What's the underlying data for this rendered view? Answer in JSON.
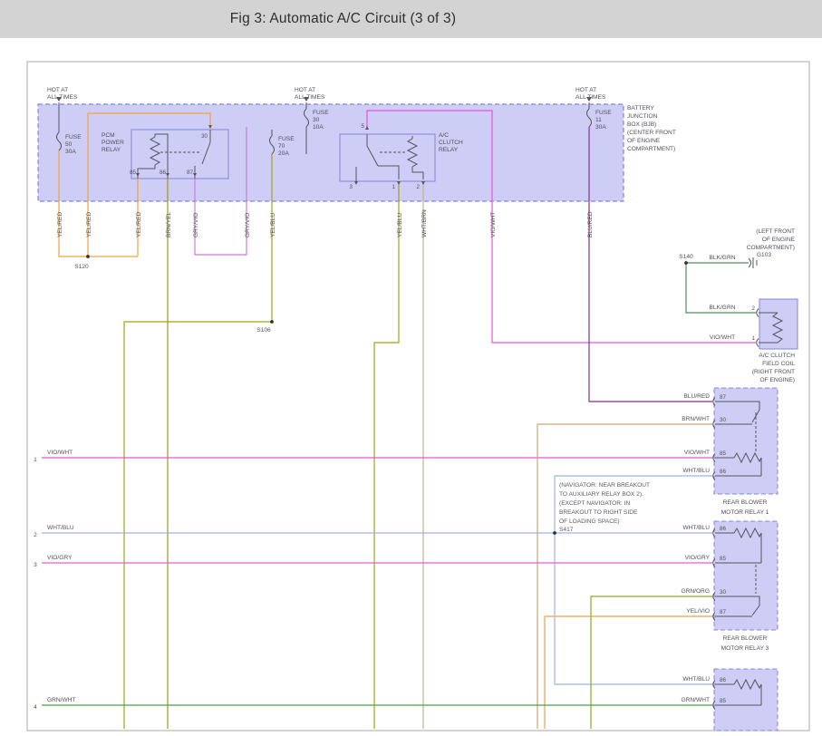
{
  "header": {
    "title": "Fig 3: Automatic A/C Circuit (3 of 3)"
  },
  "colors": {
    "yel_red": "#f2a23a",
    "brn_yel": "#ab9414",
    "gry_vio": "#cd7bd6",
    "yel_blu": "#a7a117",
    "wht_brn": "#c9b183",
    "vio_wht": "#ee4fe0",
    "blu_red": "#8b2f8b",
    "blk_grn": "#4f8f57",
    "brn_wht": "#c9a878",
    "wht_blu": "#9fb0ea",
    "vio_gry": "#e55fd2",
    "grn_org": "#84ae24",
    "yel_vio": "#eda04e",
    "grn_wht": "#46a546",
    "box_fill": "#cdcdf5",
    "box_border": "#8585da"
  },
  "bjb": {
    "hot": [
      "HOT AT",
      "ALL TIMES"
    ],
    "label": [
      "BATTERY",
      "JUNCTION",
      "BOX (BJB)",
      "(CENTER FRONT",
      "OF ENGINE",
      "COMPARTMENT)"
    ],
    "fuse50": [
      "FUSE",
      "50",
      "30A"
    ],
    "fuse30": [
      "FUSE",
      "30",
      "10A"
    ],
    "fuse70": [
      "FUSE",
      "70",
      "20A"
    ],
    "fuse11": [
      "FUSE",
      "11",
      "30A"
    ],
    "pcm_relay": [
      "PCM",
      "POWER",
      "RELAY"
    ],
    "ac_relay": [
      "A/C",
      "CLUTCH",
      "RELAY"
    ],
    "pcm_pins": [
      "30",
      "85",
      "86",
      "87"
    ],
    "ac_pins": [
      "5",
      "3",
      "1",
      "2"
    ]
  },
  "vertical_wires": [
    "YEL/RED",
    "YEL/RED",
    "YEL/RED",
    "BRN/YEL",
    "GRY/VIO",
    "GRY/VIO",
    "YEL/BLU",
    "YEL/BLU",
    "WHT/BRN",
    "VIO/WHT",
    "BLU/RED"
  ],
  "splices": {
    "s120": "S120",
    "s106": "S106",
    "s140": "S140",
    "s417": "S417"
  },
  "ground": {
    "name": "G103",
    "wire": "BLK/GRN",
    "location": [
      "(LEFT FRONT",
      "OF ENGINE",
      "COMPARTMENT)"
    ]
  },
  "field_coil": {
    "pin2": "2",
    "pin1": "1",
    "wire2": "BLK/GRN",
    "wire1": "VIO/WHT",
    "label": [
      "A/C CLUTCH",
      "FIELD COIL",
      "(RIGHT FRONT",
      "OF ENGINE)"
    ]
  },
  "relay1": {
    "label": [
      "REAR BLOWER",
      "MOTOR RELAY 1"
    ],
    "pins": [
      "87",
      "30",
      "85",
      "86"
    ],
    "wires": [
      "BLU/RED",
      "BRN/WHT",
      "VIO/WHT",
      "WHT/BLU"
    ]
  },
  "relay3": {
    "label": [
      "REAR BLOWER",
      "MOTOR RELAY 3"
    ],
    "pins": [
      "86",
      "85",
      "30",
      "87"
    ],
    "wires": [
      "WHT/BLU",
      "VIO/GRY",
      "GRN/ORG",
      "YEL/VIO"
    ]
  },
  "relay4": {
    "pins": [
      "86",
      "85"
    ],
    "wires": [
      "WHT/BLU",
      "GRN/WHT"
    ]
  },
  "left_lines": [
    {
      "num": "1",
      "label": "VIO/WHT"
    },
    {
      "num": "2",
      "label": "WHT/BLU"
    },
    {
      "num": "3",
      "label": "VIO/GRY"
    },
    {
      "num": "4",
      "label": "GRN/WHT"
    }
  ],
  "note": {
    "lines": [
      "(NAVIGATOR: NEAR BREAKOUT",
      "TO AUXILIARY RELAY BOX 2).",
      "(EXCEPT NAVIGATOR: IN",
      "BREAKOUT TO RIGHT SIDE",
      "OF LOADING SPACE)"
    ],
    "splice": "S417"
  }
}
